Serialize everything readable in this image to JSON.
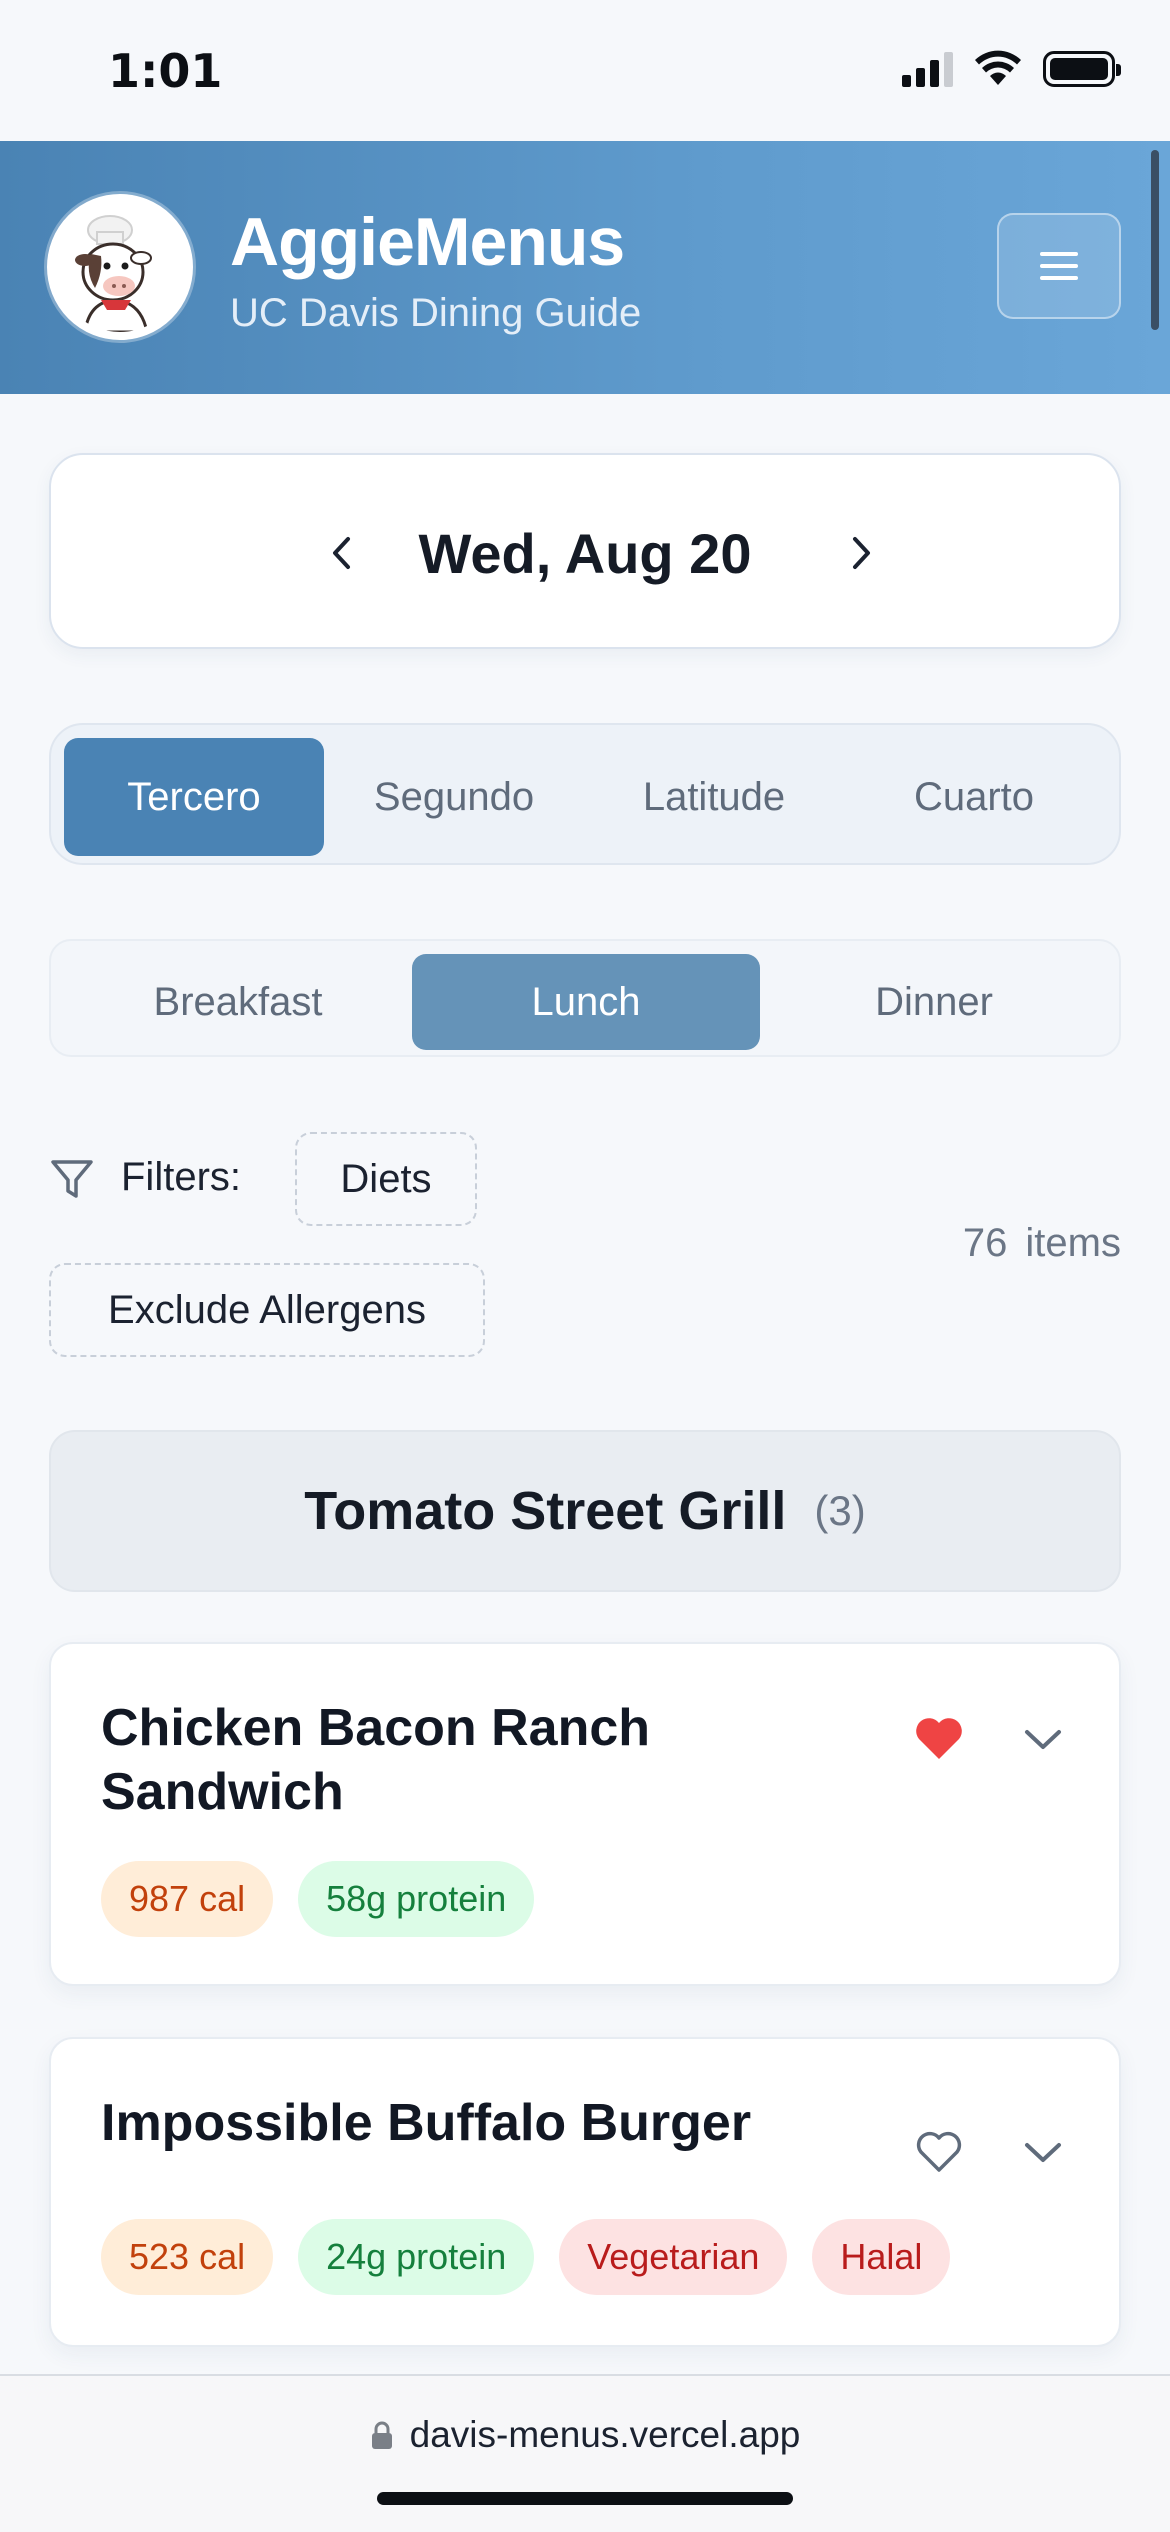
{
  "status_bar": {
    "time": "1:01"
  },
  "header": {
    "title": "AggieMenus",
    "subtitle": "UC Davis Dining Guide",
    "menu_icon": "hamburger-icon",
    "logo_icon": "cow-chef-icon"
  },
  "date_selector": {
    "prev_label": "‹",
    "date": "Wed, Aug 20",
    "next_label": "›"
  },
  "dining_halls": {
    "tabs": [
      {
        "label": "Tercero",
        "active": true
      },
      {
        "label": "Segundo",
        "active": false
      },
      {
        "label": "Latitude",
        "active": false
      },
      {
        "label": "Cuarto",
        "active": false
      }
    ]
  },
  "meals": {
    "tabs": [
      {
        "label": "Breakfast",
        "active": false
      },
      {
        "label": "Lunch",
        "active": true
      },
      {
        "label": "Dinner",
        "active": false
      }
    ]
  },
  "filters": {
    "label": "Filters:",
    "diets_label": "Diets",
    "allergens_label": "Exclude Allergens",
    "count": "76",
    "count_unit": "items"
  },
  "section": {
    "title": "Tomato Street Grill",
    "count": "(3)"
  },
  "items": [
    {
      "name": "Chicken Bacon Ranch Sandwich",
      "calories": "987 cal",
      "protein": "58g protein",
      "favorited": true,
      "diets": []
    },
    {
      "name": "Impossible Buffalo Burger",
      "calories": "523 cal",
      "protein": "24g protein",
      "favorited": false,
      "diets": [
        "Vegetarian",
        "Halal"
      ]
    }
  ],
  "browser": {
    "url": "davis-menus.vercel.app"
  },
  "colors": {
    "brand": "#4a83b4",
    "meal_active": "#6593b8",
    "heart_filled": "#ef4444",
    "calorie_tag_bg": "#ffedd8",
    "protein_tag_bg": "#dcfce7",
    "diet_tag_bg": "#fde2e2"
  }
}
